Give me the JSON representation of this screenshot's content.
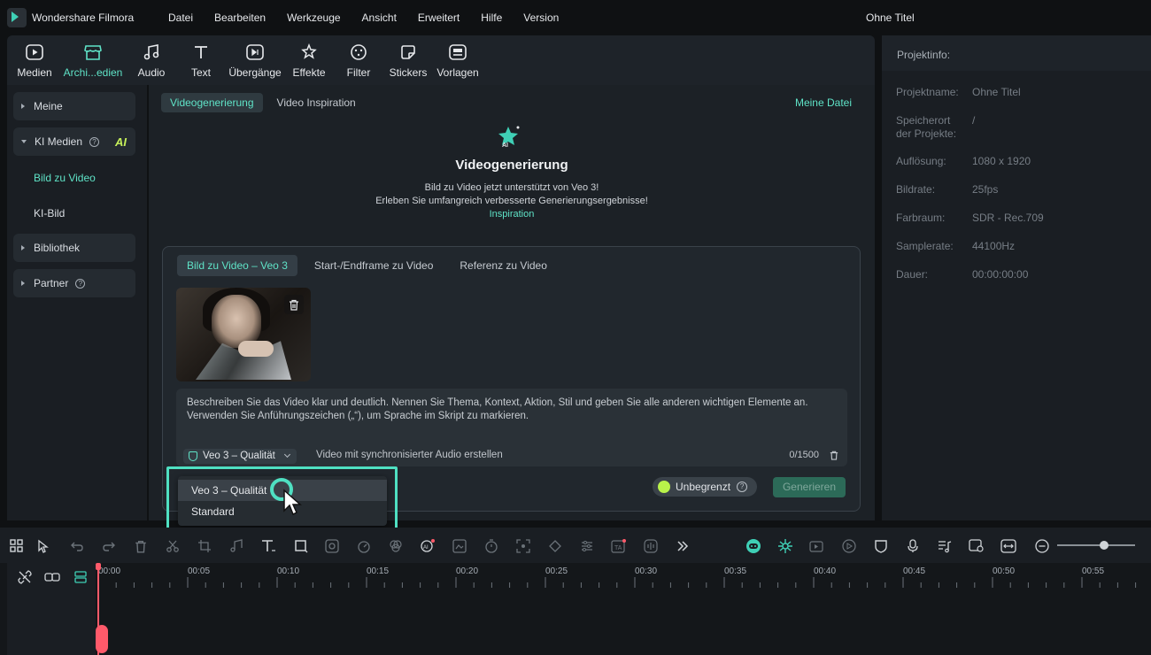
{
  "app": {
    "name": "Wondershare Filmora",
    "doc_title": "Ohne Titel"
  },
  "menu": [
    "Datei",
    "Bearbeiten",
    "Werkzeuge",
    "Ansicht",
    "Erweitert",
    "Hilfe",
    "Version"
  ],
  "toolbar": [
    {
      "label": "Medien",
      "icon": "media-icon"
    },
    {
      "label": "Archi...edien",
      "icon": "store-icon"
    },
    {
      "label": "Audio",
      "icon": "music-note-icon"
    },
    {
      "label": "Text",
      "icon": "text-icon"
    },
    {
      "label": "Übergänge",
      "icon": "transition-icon"
    },
    {
      "label": "Effekte",
      "icon": "effects-icon"
    },
    {
      "label": "Filter",
      "icon": "filter-icon"
    },
    {
      "label": "Stickers",
      "icon": "sticker-icon"
    },
    {
      "label": "Vorlagen",
      "icon": "template-icon"
    }
  ],
  "sidebar": {
    "meine": "Meine",
    "ki_medien": "KI Medien",
    "ai_badge": "AI",
    "bild_zu_video": "Bild zu Video",
    "ki_bild": "KI-Bild",
    "bibliothek": "Bibliothek",
    "partner": "Partner"
  },
  "main": {
    "tab_active": "Videogenerierung",
    "tab_other": "Video Inspiration",
    "my_file": "Meine Datei",
    "title": "Videogenerierung",
    "line1": "Bild zu Video jetzt unterstützt von Veo 3!",
    "line2": "Erleben Sie umfangreich verbesserte Generierungsergebnisse!",
    "inspiration": "Inspiration",
    "gen_tabs": [
      "Bild zu Video – Veo 3",
      "Start-/Endframe zu Video",
      "Referenz zu Video"
    ],
    "prompt_placeholder": "Beschreiben Sie das Video klar und deutlich. Nennen Sie Thema, Kontext, Aktion, Stil und geben Sie alle anderen wichtigen Elemente an. Verwenden Sie Anführungszeichen („“), um Sprache im Skript zu markieren.",
    "model": "Veo 3 – Qualität",
    "audio_note": "Video mit synchronisierter Audio erstellen",
    "char_count": "0/1500",
    "unlimited": "Unbegrenzt",
    "generate": "Generieren"
  },
  "dropdown": {
    "options": [
      "Veo 3 – Qualität",
      "Standard"
    ],
    "selected": "Veo 3 – Qualität"
  },
  "info": {
    "header": "Projektinfo:",
    "rows": [
      {
        "label": "Projektname:",
        "value": "Ohne Titel"
      },
      {
        "label": "Speicherort der Projekte:",
        "value": "/"
      },
      {
        "label": "Auflösung:",
        "value": "1080 x 1920"
      },
      {
        "label": "Bildrate:",
        "value": "25fps"
      },
      {
        "label": "Farbraum:",
        "value": "SDR - Rec.709"
      },
      {
        "label": "Samplerate:",
        "value": "44100Hz"
      },
      {
        "label": "Dauer:",
        "value": "00:00:00:00"
      }
    ]
  },
  "timeline": {
    "ruler": [
      "00:00",
      "00:05",
      "00:10",
      "00:15",
      "00:20",
      "00:25",
      "00:30",
      "00:35",
      "00:40",
      "00:45",
      "00:50",
      "00:55"
    ]
  },
  "colors": {
    "accent": "#5fe3c7",
    "highlight": "#4fe0c2",
    "playhead": "#ff5a6a"
  }
}
